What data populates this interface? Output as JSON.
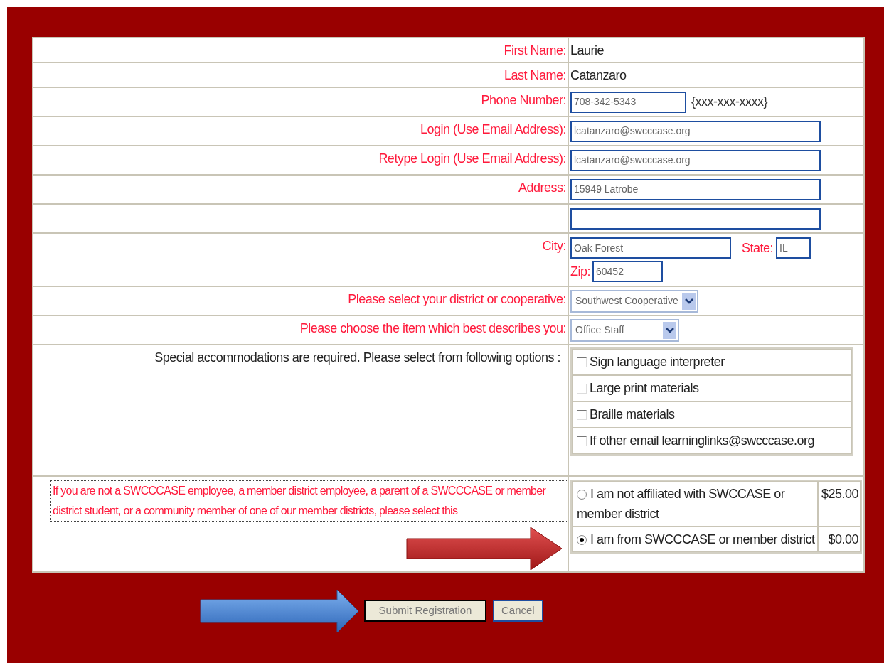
{
  "rows": [
    {
      "kind": "static",
      "label": "First Name:",
      "value": "Laurie"
    },
    {
      "kind": "static",
      "label": "Last Name:",
      "value": "Catanzaro"
    },
    {
      "kind": "input",
      "label": "Phone Number:",
      "value": "708-342-5343",
      "hint": "{xxx-xxx-xxxx}"
    },
    {
      "kind": "input",
      "label": "Login (Use Email Address):",
      "value": "lcatanzaro@swcccase.org"
    },
    {
      "kind": "input",
      "label": "Retype Login (Use Email Address):",
      "value": "lcatanzaro@swcccase.org"
    },
    {
      "kind": "input",
      "label": "Address:",
      "value": "15949 Latrobe"
    },
    {
      "kind": "input"
    },
    {
      "kind": "city",
      "label": "City:",
      "value": "Oak Forest",
      "state_label": "State:",
      "state": "IL",
      "zip_label": "Zip:",
      "zip": "60452"
    },
    {
      "kind": "select",
      "label": "Please select your district or cooperative:",
      "value": "Southwest Cooperative"
    },
    {
      "kind": "select",
      "label": "Please choose the item which best describes you:",
      "value": "Office Staff"
    }
  ],
  "accommodations": {
    "label": "Special accommodations are required. Please select from following options :",
    "options": [
      {
        "label": "Sign language interpreter",
        "checked": false
      },
      {
        "label": "Large print materials",
        "checked": false
      },
      {
        "label": "Braille materials",
        "checked": false
      },
      {
        "label": "If other email learninglinks@swcccase.org",
        "checked": false
      }
    ]
  },
  "affiliation": {
    "note": "If you are not a SWCCCASE employee, a member district employee, a parent of a SWCCCASE or member district student, or a community member of one of our member districts, please select this",
    "options": [
      {
        "label": "I am not affiliated with SWCCASE or member district",
        "price": "$25.00",
        "selected": false
      },
      {
        "label": "I am from SWCCCASE or member district",
        "price": "$0.00",
        "selected": true
      }
    ]
  },
  "buttons": [
    {
      "label": "Submit Registration",
      "default": true
    },
    {
      "label": "Cancel",
      "default": false
    }
  ]
}
